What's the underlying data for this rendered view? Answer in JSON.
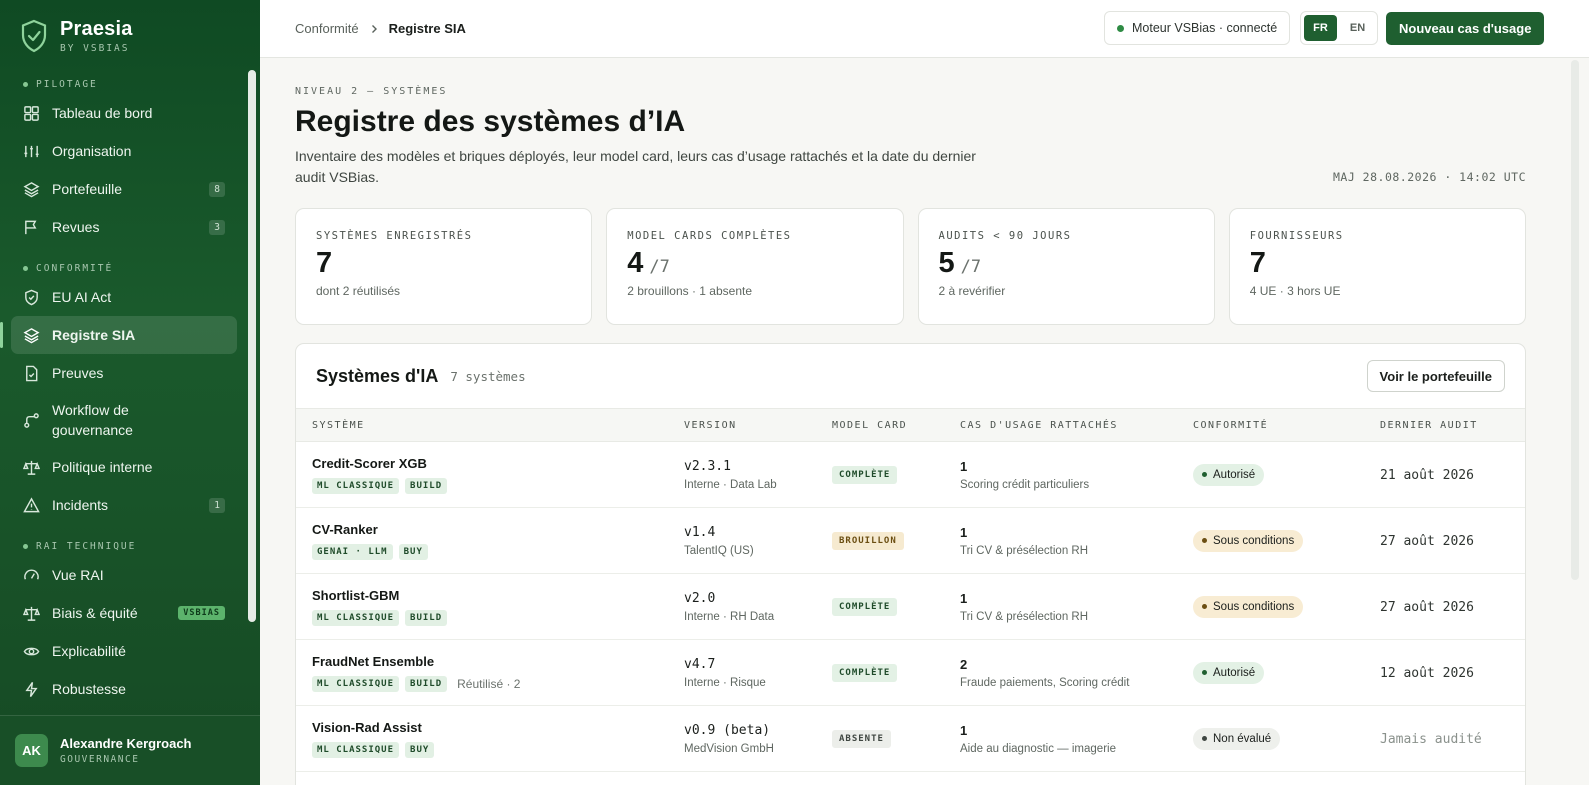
{
  "brand": {
    "name": "Praesia",
    "sub": "BY VSBIAS"
  },
  "sidebar": {
    "sections": [
      {
        "label": "PILOTAGE",
        "items": [
          {
            "label": "Tableau de bord",
            "icon": "grid-icon",
            "badge": ""
          },
          {
            "label": "Organisation",
            "icon": "sliders-icon",
            "badge": ""
          },
          {
            "label": "Portefeuille",
            "icon": "layers-icon",
            "badge": "8"
          },
          {
            "label": "Revues",
            "icon": "flag-icon",
            "badge": "3"
          }
        ]
      },
      {
        "label": "CONFORMITÉ",
        "items": [
          {
            "label": "EU AI Act",
            "icon": "shield-check-icon",
            "badge": ""
          },
          {
            "label": "Registre SIA",
            "icon": "layers-icon",
            "badge": ""
          },
          {
            "label": "Preuves",
            "icon": "file-check-icon",
            "badge": ""
          },
          {
            "label": "Workflow de gouvernance",
            "icon": "workflow-icon",
            "badge": ""
          },
          {
            "label": "Politique interne",
            "icon": "scale-icon",
            "badge": ""
          },
          {
            "label": "Incidents",
            "icon": "alert-triangle-icon",
            "badge": "1"
          }
        ]
      },
      {
        "label": "RAI TECHNIQUE",
        "items": [
          {
            "label": "Vue RAI",
            "icon": "gauge-icon",
            "badge": ""
          },
          {
            "label": "Biais & équité",
            "icon": "scale-icon",
            "badge": "VSBIAS"
          },
          {
            "label": "Explicabilité",
            "icon": "eye-icon",
            "badge": ""
          },
          {
            "label": "Robustesse",
            "icon": "bolt-icon",
            "badge": ""
          }
        ]
      }
    ],
    "active": "Registre SIA"
  },
  "user": {
    "initials": "AK",
    "name": "Alexandre Kergroach",
    "role": "GOUVERNANCE"
  },
  "topbar": {
    "crumb_parent": "Conformité",
    "crumb_current": "Registre SIA",
    "engine_status": "Moteur VSBias · connecté",
    "lang_fr": "FR",
    "lang_en": "EN",
    "new_button": "Nouveau cas d'usage"
  },
  "header": {
    "kicker": "NIVEAU 2 — SYSTÈMES",
    "title": "Registre des systèmes d’IA",
    "description": "Inventaire des modèles et briques déployés, leur model card, leurs cas d’usage rattachés et la date du dernier audit VSBias.",
    "updated": "MAJ 28.08.2026 · 14:02 UTC"
  },
  "kpis": [
    {
      "label": "SYSTÈMES ENREGISTRÉS",
      "value": "7",
      "of": "",
      "note": "dont 2 réutilisés"
    },
    {
      "label": "MODEL CARDS COMPLÈTES",
      "value": "4",
      "of": "/7",
      "note": "2 brouillons · 1 absente"
    },
    {
      "label": "AUDITS < 90 JOURS",
      "value": "5",
      "of": "/7",
      "note": "2 à revérifier"
    },
    {
      "label": "FOURNISSEURS",
      "value": "7",
      "of": "",
      "note": "4 UE · 3 hors UE"
    }
  ],
  "table": {
    "title": "Systèmes d'IA",
    "count": "7 systèmes",
    "button": "Voir le portefeuille",
    "columns": [
      "SYSTÈME",
      "VERSION",
      "MODEL CARD",
      "CAS D'USAGE RATTACHÉS",
      "CONFORMITÉ",
      "DERNIER AUDIT"
    ],
    "rows": [
      {
        "name": "Credit-Scorer XGB",
        "tags": [
          "ML CLASSIQUE",
          "BUILD"
        ],
        "reuse": "",
        "version": "v2.3.1",
        "origin": "Interne · Data Lab",
        "model_card": "COMPLÈTE",
        "mc_kind": "ok",
        "uc_count": "1",
        "uc_list": "Scoring crédit particuliers",
        "status": "Autorisé",
        "status_kind": "auth",
        "audit": "21 août 2026"
      },
      {
        "name": "CV-Ranker",
        "tags": [
          "GENAI · LLM",
          "BUY"
        ],
        "reuse": "",
        "version": "v1.4",
        "origin": "TalentIQ (US)",
        "model_card": "BROUILLON",
        "mc_kind": "draft",
        "uc_count": "1",
        "uc_list": "Tri CV & présélection RH",
        "status": "Sous conditions",
        "status_kind": "cond",
        "audit": "27 août 2026"
      },
      {
        "name": "Shortlist-GBM",
        "tags": [
          "ML CLASSIQUE",
          "BUILD"
        ],
        "reuse": "",
        "version": "v2.0",
        "origin": "Interne · RH Data",
        "model_card": "COMPLÈTE",
        "mc_kind": "ok",
        "uc_count": "1",
        "uc_list": "Tri CV & présélection RH",
        "status": "Sous conditions",
        "status_kind": "cond",
        "audit": "27 août 2026"
      },
      {
        "name": "FraudNet Ensemble",
        "tags": [
          "ML CLASSIQUE",
          "BUILD"
        ],
        "reuse": "Réutilisé · 2",
        "version": "v4.7",
        "origin": "Interne · Risque",
        "model_card": "COMPLÈTE",
        "mc_kind": "ok",
        "uc_count": "2",
        "uc_list": "Fraude paiements, Scoring crédit",
        "status": "Autorisé",
        "status_kind": "auth",
        "audit": "12 août 2026"
      },
      {
        "name": "Vision-Rad Assist",
        "tags": [
          "ML CLASSIQUE",
          "BUY"
        ],
        "reuse": "",
        "version": "v0.9 (beta)",
        "origin": "MedVision GmbH",
        "model_card": "ABSENTE",
        "mc_kind": "none",
        "uc_count": "1",
        "uc_list": "Aide au diagnostic — imagerie",
        "status": "Non évalué",
        "status_kind": "none",
        "audit": "Jamais audité"
      }
    ]
  }
}
